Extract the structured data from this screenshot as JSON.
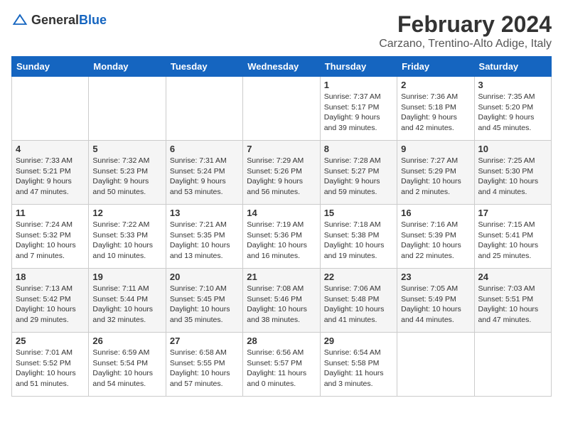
{
  "header": {
    "logo_general": "General",
    "logo_blue": "Blue",
    "month_title": "February 2024",
    "location": "Carzano, Trentino-Alto Adige, Italy"
  },
  "calendar": {
    "days_of_week": [
      "Sunday",
      "Monday",
      "Tuesday",
      "Wednesday",
      "Thursday",
      "Friday",
      "Saturday"
    ],
    "weeks": [
      [
        {
          "day": "",
          "content": ""
        },
        {
          "day": "",
          "content": ""
        },
        {
          "day": "",
          "content": ""
        },
        {
          "day": "",
          "content": ""
        },
        {
          "day": "1",
          "content": "Sunrise: 7:37 AM\nSunset: 5:17 PM\nDaylight: 9 hours\nand 39 minutes."
        },
        {
          "day": "2",
          "content": "Sunrise: 7:36 AM\nSunset: 5:18 PM\nDaylight: 9 hours\nand 42 minutes."
        },
        {
          "day": "3",
          "content": "Sunrise: 7:35 AM\nSunset: 5:20 PM\nDaylight: 9 hours\nand 45 minutes."
        }
      ],
      [
        {
          "day": "4",
          "content": "Sunrise: 7:33 AM\nSunset: 5:21 PM\nDaylight: 9 hours\nand 47 minutes."
        },
        {
          "day": "5",
          "content": "Sunrise: 7:32 AM\nSunset: 5:23 PM\nDaylight: 9 hours\nand 50 minutes."
        },
        {
          "day": "6",
          "content": "Sunrise: 7:31 AM\nSunset: 5:24 PM\nDaylight: 9 hours\nand 53 minutes."
        },
        {
          "day": "7",
          "content": "Sunrise: 7:29 AM\nSunset: 5:26 PM\nDaylight: 9 hours\nand 56 minutes."
        },
        {
          "day": "8",
          "content": "Sunrise: 7:28 AM\nSunset: 5:27 PM\nDaylight: 9 hours\nand 59 minutes."
        },
        {
          "day": "9",
          "content": "Sunrise: 7:27 AM\nSunset: 5:29 PM\nDaylight: 10 hours\nand 2 minutes."
        },
        {
          "day": "10",
          "content": "Sunrise: 7:25 AM\nSunset: 5:30 PM\nDaylight: 10 hours\nand 4 minutes."
        }
      ],
      [
        {
          "day": "11",
          "content": "Sunrise: 7:24 AM\nSunset: 5:32 PM\nDaylight: 10 hours\nand 7 minutes."
        },
        {
          "day": "12",
          "content": "Sunrise: 7:22 AM\nSunset: 5:33 PM\nDaylight: 10 hours\nand 10 minutes."
        },
        {
          "day": "13",
          "content": "Sunrise: 7:21 AM\nSunset: 5:35 PM\nDaylight: 10 hours\nand 13 minutes."
        },
        {
          "day": "14",
          "content": "Sunrise: 7:19 AM\nSunset: 5:36 PM\nDaylight: 10 hours\nand 16 minutes."
        },
        {
          "day": "15",
          "content": "Sunrise: 7:18 AM\nSunset: 5:38 PM\nDaylight: 10 hours\nand 19 minutes."
        },
        {
          "day": "16",
          "content": "Sunrise: 7:16 AM\nSunset: 5:39 PM\nDaylight: 10 hours\nand 22 minutes."
        },
        {
          "day": "17",
          "content": "Sunrise: 7:15 AM\nSunset: 5:41 PM\nDaylight: 10 hours\nand 25 minutes."
        }
      ],
      [
        {
          "day": "18",
          "content": "Sunrise: 7:13 AM\nSunset: 5:42 PM\nDaylight: 10 hours\nand 29 minutes."
        },
        {
          "day": "19",
          "content": "Sunrise: 7:11 AM\nSunset: 5:44 PM\nDaylight: 10 hours\nand 32 minutes."
        },
        {
          "day": "20",
          "content": "Sunrise: 7:10 AM\nSunset: 5:45 PM\nDaylight: 10 hours\nand 35 minutes."
        },
        {
          "day": "21",
          "content": "Sunrise: 7:08 AM\nSunset: 5:46 PM\nDaylight: 10 hours\nand 38 minutes."
        },
        {
          "day": "22",
          "content": "Sunrise: 7:06 AM\nSunset: 5:48 PM\nDaylight: 10 hours\nand 41 minutes."
        },
        {
          "day": "23",
          "content": "Sunrise: 7:05 AM\nSunset: 5:49 PM\nDaylight: 10 hours\nand 44 minutes."
        },
        {
          "day": "24",
          "content": "Sunrise: 7:03 AM\nSunset: 5:51 PM\nDaylight: 10 hours\nand 47 minutes."
        }
      ],
      [
        {
          "day": "25",
          "content": "Sunrise: 7:01 AM\nSunset: 5:52 PM\nDaylight: 10 hours\nand 51 minutes."
        },
        {
          "day": "26",
          "content": "Sunrise: 6:59 AM\nSunset: 5:54 PM\nDaylight: 10 hours\nand 54 minutes."
        },
        {
          "day": "27",
          "content": "Sunrise: 6:58 AM\nSunset: 5:55 PM\nDaylight: 10 hours\nand 57 minutes."
        },
        {
          "day": "28",
          "content": "Sunrise: 6:56 AM\nSunset: 5:57 PM\nDaylight: 11 hours\nand 0 minutes."
        },
        {
          "day": "29",
          "content": "Sunrise: 6:54 AM\nSunset: 5:58 PM\nDaylight: 11 hours\nand 3 minutes."
        },
        {
          "day": "",
          "content": ""
        },
        {
          "day": "",
          "content": ""
        }
      ]
    ]
  }
}
